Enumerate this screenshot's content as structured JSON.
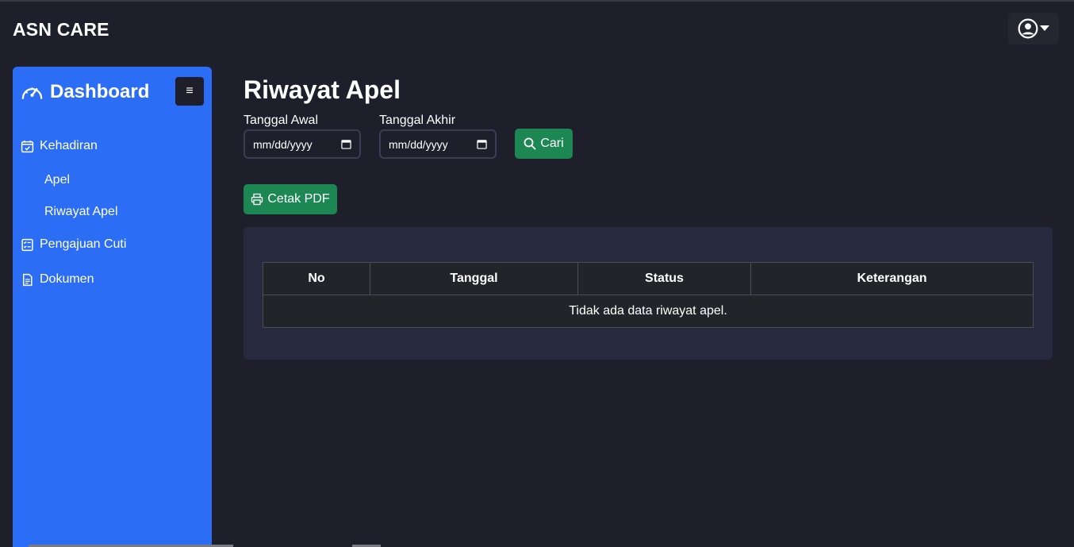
{
  "app": {
    "brand": "ASN CARE"
  },
  "navbar": {
    "user_icon": "user-circle-icon",
    "caret_icon": "caret-down-icon"
  },
  "sidebar": {
    "title": "Dashboard",
    "title_icon": "speedometer-icon",
    "toggle_icon": "hamburger-icon",
    "items": [
      {
        "label": "Kehadiran",
        "icon": "calendar-check-icon"
      },
      {
        "label": "Apel"
      },
      {
        "label": "Riwayat Apel"
      },
      {
        "label": "Pengajuan Cuti",
        "icon": "checklist-icon"
      },
      {
        "label": "Dokumen",
        "icon": "document-icon"
      }
    ]
  },
  "main": {
    "title": "Riwayat Apel",
    "filters": {
      "start_label": "Tanggal Awal",
      "start_value": "mm/dd/yyyy",
      "end_label": "Tanggal Akhir",
      "end_value": "mm/dd/yyyy",
      "search_label": "Cari"
    },
    "print_label": "Cetak PDF",
    "table": {
      "headers": [
        "No",
        "Tanggal",
        "Status",
        "Keterangan"
      ],
      "empty_message": "Tidak ada data riwayat apel."
    }
  },
  "colors": {
    "background": "#1f1f2b",
    "sidebar": "#2c6df5",
    "button_green": "#1d8754",
    "card": "#272a3e",
    "table": "#212529"
  }
}
